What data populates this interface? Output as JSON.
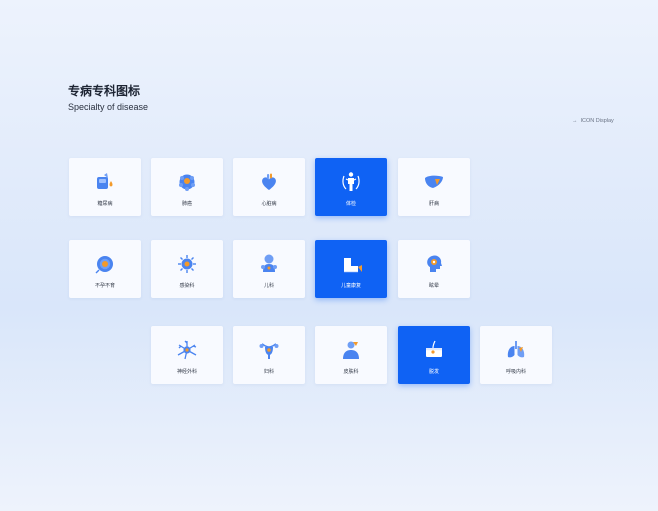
{
  "header": {
    "title": "专病专科图标",
    "subtitle": "Specialty of disease",
    "display_label": "ICON Display"
  },
  "colors": {
    "accent": "#0f62f4",
    "icon_blue": "#4a84f0",
    "icon_orange": "#f39a2b",
    "card_bg": "#f8faff"
  },
  "cards": [
    {
      "label": "糖尿病",
      "icon": "diabetes-icon",
      "active": false
    },
    {
      "label": "肺癌",
      "icon": "lung-cancer-icon",
      "active": false
    },
    {
      "label": "心脏病",
      "icon": "heart-disease-icon",
      "active": false
    },
    {
      "label": "体检",
      "icon": "physical-exam-icon",
      "active": true
    },
    {
      "label": "肝病",
      "icon": "liver-disease-icon",
      "active": false
    },
    {
      "label": "不孕不育",
      "icon": "infertility-icon",
      "active": false
    },
    {
      "label": "感染科",
      "icon": "infection-icon",
      "active": false
    },
    {
      "label": "儿科",
      "icon": "pediatrics-icon",
      "active": false
    },
    {
      "label": "儿童康复",
      "icon": "child-rehab-icon",
      "active": true
    },
    {
      "label": "眩晕",
      "icon": "vertigo-icon",
      "active": false
    },
    {
      "label": "神经外科",
      "icon": "neurosurgery-icon",
      "active": false
    },
    {
      "label": "妇科",
      "icon": "gynecology-icon",
      "active": false
    },
    {
      "label": "皮肤科",
      "icon": "dermatology-icon",
      "active": false
    },
    {
      "label": "脱发",
      "icon": "hair-loss-icon",
      "active": true
    },
    {
      "label": "呼吸内科",
      "icon": "respiratory-icon",
      "active": false
    }
  ]
}
